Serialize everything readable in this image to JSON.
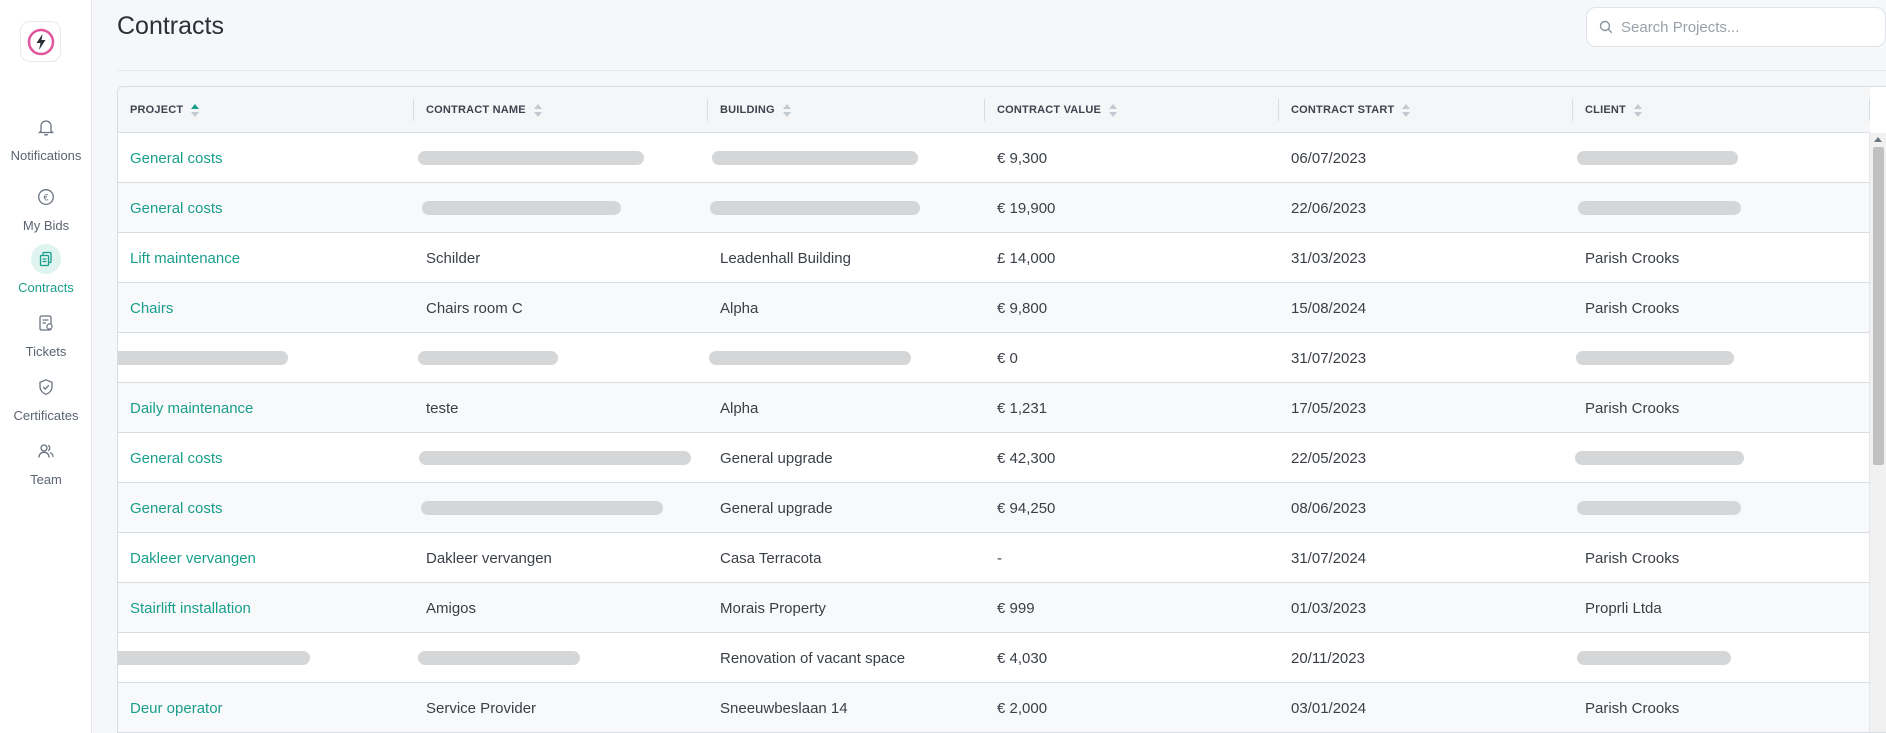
{
  "sidebar": {
    "logo_icon": "lightning-bolt-icon",
    "items": [
      {
        "label": "Notifications",
        "icon": "bell-icon",
        "active": false
      },
      {
        "label": "My Bids",
        "icon": "euro-icon",
        "active": false
      },
      {
        "label": "Contracts",
        "icon": "contract-documents-icon",
        "active": true
      },
      {
        "label": "Tickets",
        "icon": "ticket-icon",
        "active": false
      },
      {
        "label": "Certificates",
        "icon": "shield-check-icon",
        "active": false
      },
      {
        "label": "Team",
        "icon": "team-icon",
        "active": false
      }
    ]
  },
  "header": {
    "title": "Contracts",
    "search_placeholder": "Search Projects..."
  },
  "table": {
    "columns": [
      {
        "label": "PROJECT",
        "sort": "ascending"
      },
      {
        "label": "CONTRACT NAME",
        "sort": "none"
      },
      {
        "label": "BUILDING",
        "sort": "none"
      },
      {
        "label": "CONTRACT VALUE",
        "sort": "none"
      },
      {
        "label": "CONTRACT START",
        "sort": "none"
      },
      {
        "label": "CLIENT",
        "sort": "none"
      }
    ],
    "rows": [
      {
        "project": "General costs",
        "contract_name": "",
        "building": "",
        "contract_value": "€ 9,300",
        "contract_start": "06/07/2023",
        "client": ""
      },
      {
        "project": "General costs",
        "contract_name": "",
        "building": "",
        "contract_value": "€ 19,900",
        "contract_start": "22/06/2023",
        "client": ""
      },
      {
        "project": "Lift maintenance",
        "contract_name": "Schilder",
        "building": "Leadenhall Building",
        "contract_value": "£ 14,000",
        "contract_start": "31/03/2023",
        "client": "Parish Crooks"
      },
      {
        "project": "Chairs",
        "contract_name": "Chairs room C",
        "building": "Alpha",
        "contract_value": "€ 9,800",
        "contract_start": "15/08/2024",
        "client": "Parish Crooks"
      },
      {
        "project": "",
        "contract_name": "",
        "building": "",
        "contract_value": "€ 0",
        "contract_start": "31/07/2023",
        "client": ""
      },
      {
        "project": "Daily maintenance",
        "contract_name": "teste",
        "building": "Alpha",
        "contract_value": "€ 1,231",
        "contract_start": "17/05/2023",
        "client": "Parish Crooks"
      },
      {
        "project": "General costs",
        "contract_name": "",
        "building": "General upgrade",
        "contract_value": "€ 42,300",
        "contract_start": "22/05/2023",
        "client": ""
      },
      {
        "project": "General costs",
        "contract_name": "",
        "building": "General upgrade",
        "contract_value": "€ 94,250",
        "contract_start": "08/06/2023",
        "client": ""
      },
      {
        "project": "Dakleer vervangen",
        "contract_name": "Dakleer vervangen",
        "building": "Casa Terracota",
        "contract_value": "-",
        "contract_start": "31/07/2024",
        "client": "Parish Crooks"
      },
      {
        "project": "Stairlift installation",
        "contract_name": "Amigos",
        "building": "Morais Property",
        "contract_value": "€ 999",
        "contract_start": "01/03/2023",
        "client": "Proprli Ltda"
      },
      {
        "project": "",
        "contract_name": "",
        "building": "Renovation of vacant space",
        "contract_value": "€ 4,030",
        "contract_start": "20/11/2023",
        "client": ""
      },
      {
        "project": "Deur operator",
        "contract_name": "Service Provider",
        "building": "Sneeuwbeslaan 14",
        "contract_value": "€ 2,000",
        "contract_start": "03/01/2024",
        "client": "Parish Crooks"
      }
    ]
  },
  "colors": {
    "accent": "#1a9e8c",
    "text": "#3a3f47",
    "redacted": "#d5d6d8",
    "logo_pink": "#e0559b"
  }
}
